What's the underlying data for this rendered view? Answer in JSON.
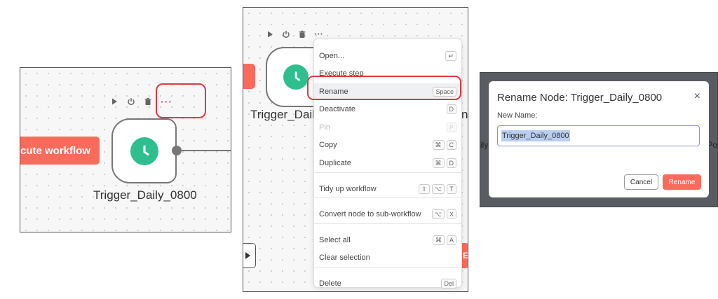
{
  "panel1": {
    "execute_label": "cute workflow",
    "node_label": "Trigger_Daily_0800"
  },
  "panel2": {
    "node_label": "Trigger_Daily_",
    "right_fragment": "n",
    "bottom_fragment": "E",
    "menu": [
      {
        "label": "Open...",
        "keys": [
          "↵"
        ]
      },
      {
        "label": "Execute step",
        "keys": []
      },
      {
        "label": "Rename",
        "keys": [
          "Space"
        ],
        "highlighted": true
      },
      {
        "label": "Deactivate",
        "keys": [
          "D"
        ]
      },
      {
        "label": "Pin",
        "keys": [
          "P"
        ],
        "disabled": true
      },
      {
        "label": "Copy",
        "keys": [
          "⌘",
          "C"
        ]
      },
      {
        "label": "Duplicate",
        "keys": [
          "⌘",
          "D"
        ]
      },
      {
        "label": "Tidy up workflow",
        "keys": [
          "⇧",
          "⌥",
          "T"
        ]
      },
      {
        "label": "Convert node to sub-workflow",
        "keys": [
          "⌥",
          "X"
        ]
      },
      {
        "label": "Select all",
        "keys": [
          "⌘",
          "A"
        ]
      },
      {
        "label": "Clear selection",
        "keys": []
      },
      {
        "label": "Delete",
        "keys": [
          "Del"
        ]
      }
    ]
  },
  "panel3": {
    "title": "Rename Node: Trigger_Daily_0800",
    "close": "×",
    "field_label": "New Name:",
    "field_value": "Trigger_Daily_0800",
    "cancel": "Cancel",
    "rename": "Rename",
    "bg_fragment_left": "ily",
    "bg_fragment_right": "Po"
  },
  "colors": {
    "accent": "#fb6b5b",
    "node_icon": "#2fbf8f",
    "highlight_outline": "#e0393e"
  },
  "icons": [
    "play-icon",
    "power-icon",
    "trash-icon",
    "more-icon",
    "clock-icon",
    "close-icon"
  ]
}
